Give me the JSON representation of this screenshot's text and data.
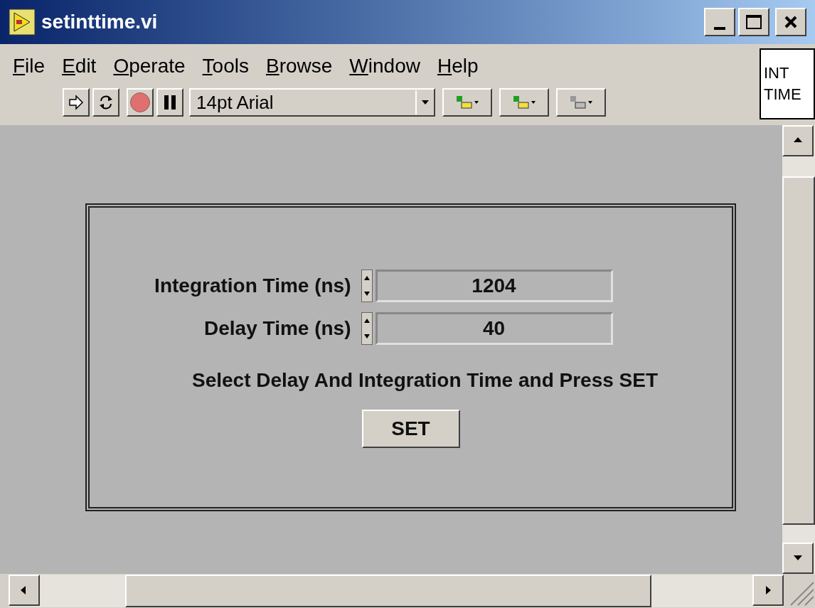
{
  "window": {
    "title": "setinttime.vi"
  },
  "menu": [
    "File",
    "Edit",
    "Operate",
    "Tools",
    "Browse",
    "Window",
    "Help"
  ],
  "toolbar": {
    "font": "14pt Arial"
  },
  "vi_icon": {
    "lines": [
      "INT",
      "TIME"
    ]
  },
  "panel": {
    "controls": [
      {
        "label": "Integration Time (ns)",
        "value": "1204"
      },
      {
        "label": "Delay Time (ns)",
        "value": "40"
      }
    ],
    "instruction": "Select Delay And Integration Time and Press SET",
    "button": "SET"
  }
}
